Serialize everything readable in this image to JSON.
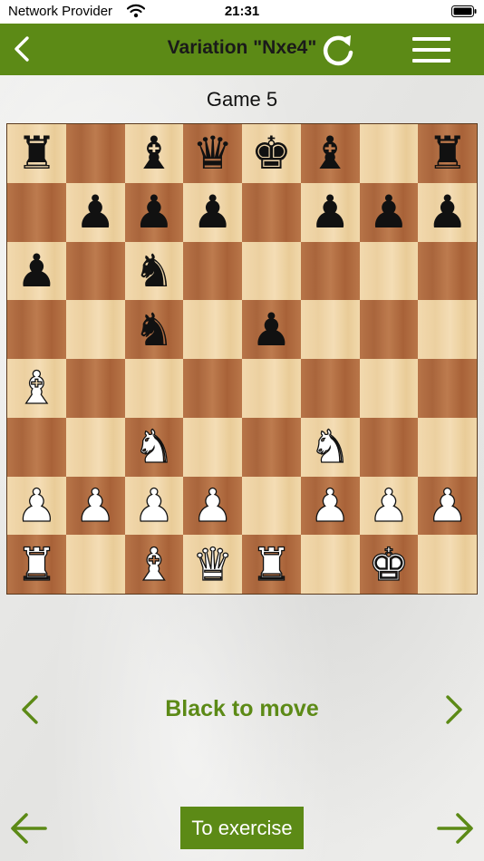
{
  "status_bar": {
    "carrier": "Network Provider",
    "time": "21:31",
    "icons": [
      "wifi-icon",
      "battery-icon"
    ]
  },
  "nav": {
    "title": "Variation \"Nxe4\"",
    "back_icon": "chevron-left-icon",
    "refresh_icon": "refresh-icon",
    "menu_icon": "hamburger-menu-icon",
    "color": "#5c8a16"
  },
  "game_title": "Game 5",
  "board": {
    "orientation": "white-bottom",
    "ranks": [
      [
        "br",
        "",
        "bb",
        "bq",
        "bk",
        "bb",
        "",
        "br"
      ],
      [
        "",
        "bp",
        "bp",
        "bp",
        "",
        "bp",
        "bp",
        "bp"
      ],
      [
        "bp",
        "",
        "bn",
        "",
        "",
        "",
        "",
        ""
      ],
      [
        "",
        "",
        "bn",
        "",
        "bp",
        "",
        "",
        ""
      ],
      [
        "wb",
        "",
        "",
        "",
        "",
        "",
        "",
        ""
      ],
      [
        "",
        "",
        "wn",
        "",
        "",
        "wn",
        "",
        ""
      ],
      [
        "wp",
        "wp",
        "wp",
        "wp",
        "",
        "wp",
        "wp",
        "wp"
      ],
      [
        "wr",
        "",
        "wb",
        "wq",
        "wr",
        "",
        "wk",
        ""
      ]
    ],
    "light_color": "#f0d6a8",
    "dark_color": "#b26f43"
  },
  "move_nav": {
    "text": "Black to move",
    "prev_icon": "chevron-left-icon",
    "next_icon": "chevron-right-icon",
    "color": "#5c8a16"
  },
  "bottom": {
    "exercise_label": "To exercise",
    "prev_icon": "arrow-left-icon",
    "next_icon": "arrow-right-icon"
  }
}
